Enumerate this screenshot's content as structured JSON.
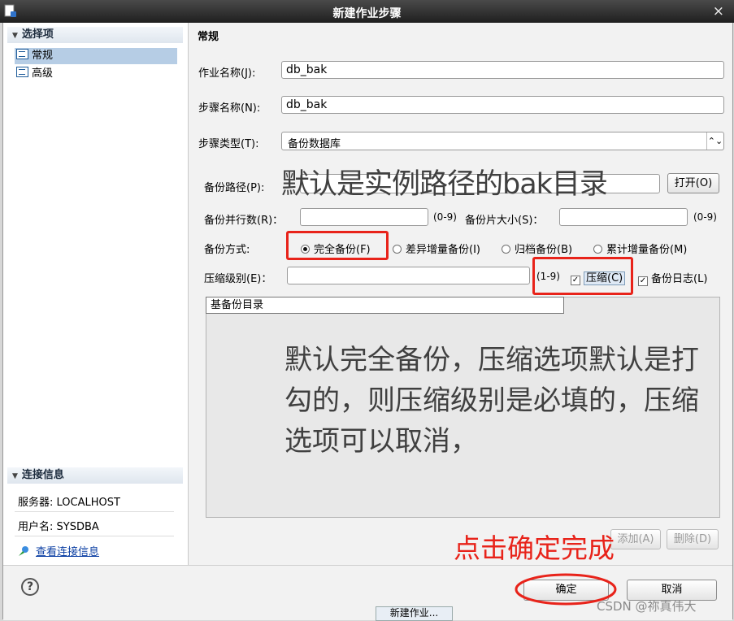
{
  "window": {
    "title": "新建作业步骤",
    "close_glyph": "×"
  },
  "left_nav": {
    "header": "选择项",
    "items": [
      {
        "label": "常规",
        "selected": true
      },
      {
        "label": "高级",
        "selected": false
      }
    ],
    "connection": {
      "header": "连接信息",
      "server": "服务器: LOCALHOST",
      "user": "用户名: SYSDBA",
      "link": "查看连接信息"
    }
  },
  "form": {
    "section_title": "常规",
    "job_name_label": "作业名称(J):",
    "job_name_value": "db_bak",
    "step_name_label": "步骤名称(N):",
    "step_name_value": "db_bak",
    "step_type_label": "步骤类型(T):",
    "step_type_value": "备份数据库",
    "backup_path_label": "备份路径(P):",
    "open_button": "打开(O)",
    "parallel_label": "备份并行数(R)：",
    "parallel_range": "(0-9)",
    "piece_size_label": "备份片大小(S)：",
    "piece_size_range": "(0-9)",
    "mode_label": "备份方式:",
    "modes": [
      {
        "label": "完全备份(F)",
        "checked": true
      },
      {
        "label": "差异增量备份(I)",
        "checked": false
      },
      {
        "label": "归档备份(B)",
        "checked": false
      },
      {
        "label": "累计增量备份(M)",
        "checked": false
      }
    ],
    "compress_level_label": "压缩级别(E)：",
    "compress_range": "(1-9)",
    "compress_label": "压缩(C)",
    "compress_checked": true,
    "log_label": "备份日志(L)",
    "log_checked": true,
    "base_dir_tab": "基备份目录",
    "add_button": "添加(A)",
    "delete_button": "删除(D)"
  },
  "annotations": {
    "path_note": "默认是实例路径的bak目录",
    "main_note": "默认完全备份，压缩选项默认是打勾的，则压缩级别是必填的，压缩选项可以取消，",
    "click_note": "点击确定完成"
  },
  "footer": {
    "help_glyph": "?",
    "ok_button": "确定",
    "cancel_button": "取消",
    "taskbar_tab": "新建作业...",
    "watermark": "CSDN @祢真伟大"
  },
  "colors": {
    "annotation_red": "#e8231a",
    "selected_nav": "#b6cde5",
    "title_bar": "#2b2b2b"
  }
}
